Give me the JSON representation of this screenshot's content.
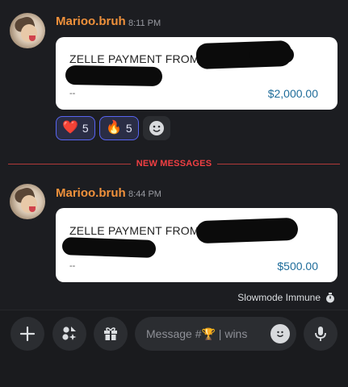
{
  "messages": [
    {
      "username": "Marioo.bruh",
      "time": "8:11 PM",
      "embed": {
        "title": "ZELLE PAYMENT FROM",
        "footer": "--",
        "amount": "$2,000.00"
      },
      "reactions": [
        {
          "emoji": "❤️",
          "count": "5"
        },
        {
          "emoji": "🔥",
          "count": "5"
        }
      ]
    },
    {
      "username": "Marioo.bruh",
      "time": "8:44 PM",
      "embed": {
        "title": "ZELLE PAYMENT FROM",
        "footer": "--",
        "amount": "$500.00"
      }
    }
  ],
  "divider": {
    "label": "NEW MESSAGES"
  },
  "slowmode": {
    "label": "Slowmode Immune"
  },
  "composer": {
    "placeholder": "Message #🏆 | wins"
  },
  "colors": {
    "background": "#1c1d21",
    "username": "#f0913b",
    "new_messages": "#f23f43",
    "amount": "#1e6c9a",
    "reaction_border": "#5865f2"
  },
  "icons": [
    "add-reaction-icon",
    "plus-icon",
    "apps-icon",
    "gift-icon",
    "emoji-icon",
    "microphone-icon",
    "stopwatch-icon"
  ]
}
